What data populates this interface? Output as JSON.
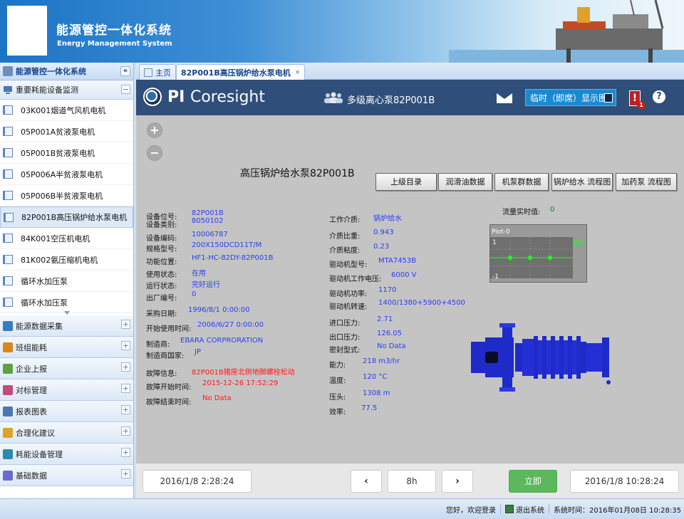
{
  "banner": {
    "title_cn": "能源管控一体化系统",
    "title_en": "Energy Management System"
  },
  "left_panel": {
    "header": "能源管控一体化系统",
    "collapse_glyph": "«",
    "section_open": {
      "label": "重要耗能设备监测",
      "toggle": "−"
    },
    "items": [
      "03K001烟道气风机电机",
      "05P001A贫液泵电机",
      "05P001B贫液泵电机",
      "05P006A半贫液泵电机",
      "05P006B半贫液泵电机",
      "82P001B高压锅炉给水泵电机",
      "84K001空压机电机",
      "81K002氨压缩机电机",
      "循环水加压泵",
      "循环水加压泵"
    ],
    "selected_index": 5,
    "sections": [
      {
        "label": "能源数据采集",
        "toggle": "+"
      },
      {
        "label": "班组能耗",
        "toggle": "+"
      },
      {
        "label": "企业上报",
        "toggle": "+"
      },
      {
        "label": "对标管理",
        "toggle": "+"
      },
      {
        "label": "报表图表",
        "toggle": "+"
      },
      {
        "label": "合理化建议",
        "toggle": "+"
      },
      {
        "label": "耗能设备管理",
        "toggle": "+"
      },
      {
        "label": "基础数据",
        "toggle": "+"
      }
    ]
  },
  "tabs": [
    {
      "label": "主页"
    },
    {
      "label": "82P001B高压锅炉给水泵电机",
      "close": "×"
    }
  ],
  "pi": {
    "brand_prefix": "PI ",
    "brand_suffix": "Coresight",
    "display_title": "多级离心泵82P001B",
    "adhoc_button": "临时（即席）显示图",
    "alert_badge": "1",
    "alert_glyph": "!",
    "help_glyph": "?",
    "zoom_in": "+",
    "zoom_out": "−"
  },
  "display": {
    "title": "高压锅炉给水泵82P001B",
    "nav_buttons": [
      "上级目录",
      "润滑油数据",
      "机泵群数据",
      "锅炉给水 流程图",
      "加药泵 流程图"
    ],
    "col1": [
      {
        "label": "设备位号:",
        "value": "82P001B"
      },
      {
        "label": "设备类别:",
        "value": "8050102"
      },
      {
        "label": "设备编码:",
        "value": "10006787"
      },
      {
        "label": "规格型号:",
        "value": "200X150DCD11T/M"
      },
      {
        "label": "功能位置:",
        "value": "HF1-HC-82DY-82P001B"
      },
      {
        "label": "使用状态:",
        "value": "在用"
      },
      {
        "label": "运行状态:",
        "value": "完好运行"
      },
      {
        "label": "出厂编号:",
        "value": "0"
      },
      {
        "label": "采购日期:",
        "value": "1996/8/1 0:00:00"
      },
      {
        "label": "开始使用时间:",
        "value": "2006/6/27 0:00:00"
      },
      {
        "label": "制造商:",
        "value": "EBARA CORPRORATION"
      },
      {
        "label": "制造商国家:",
        "value": "JP"
      },
      {
        "label": "故障信息:",
        "value": "82P001B猪座北侧地脚螺栓松动"
      },
      {
        "label": "故障开始时间:",
        "value": "2015-12-26 17:52:29"
      },
      {
        "label": "故障结束时间:",
        "value": "No Data"
      }
    ],
    "col2": [
      {
        "label": "工作介质:",
        "value": "锅炉给水"
      },
      {
        "label": "介质比重:",
        "value": "0.943"
      },
      {
        "label": "介质粘度:",
        "value": "0.23"
      },
      {
        "label": "驱动机型号:",
        "value": "MTA7453B"
      },
      {
        "label": "驱动机工作电压:",
        "value": "6000 V"
      },
      {
        "label": "驱动机功率:",
        "value": "1170"
      },
      {
        "label": "驱动机转速:",
        "value": "1400/1380+5900+4500"
      },
      {
        "label": "进口压力:",
        "value": "2.71"
      },
      {
        "label": "出口压力:",
        "value": "126.05"
      },
      {
        "label": "密封型式:",
        "value": "No Data"
      },
      {
        "label": "能力:",
        "value": "218 m3/hr"
      },
      {
        "label": "温度:",
        "value": "120 °C"
      },
      {
        "label": "压头:",
        "value": "1308 m"
      },
      {
        "label": "效率:",
        "value": "77.5"
      }
    ],
    "flow": {
      "label": "流量实时值:",
      "value": "0"
    },
    "trend": {
      "title": "Piot-0",
      "y_top": "1",
      "y_bottom": "-1",
      "current": "0"
    }
  },
  "timebar": {
    "start": "2016/1/8 2:28:24",
    "prev": "‹",
    "duration": "8h",
    "next": "›",
    "now": "立即",
    "end": "2016/1/8 10:28:24"
  },
  "status": {
    "greeting": "您好，欢迎登录",
    "exit": "退出系统",
    "time_label": "系统时间：",
    "time": "2016年01月08日 10:28:35"
  },
  "colors": {
    "pi_bar": "#2f4e7a",
    "value_blue": "#2a3ff0",
    "fault_red": "#ff1a1a",
    "now_green": "#5cb85c"
  }
}
